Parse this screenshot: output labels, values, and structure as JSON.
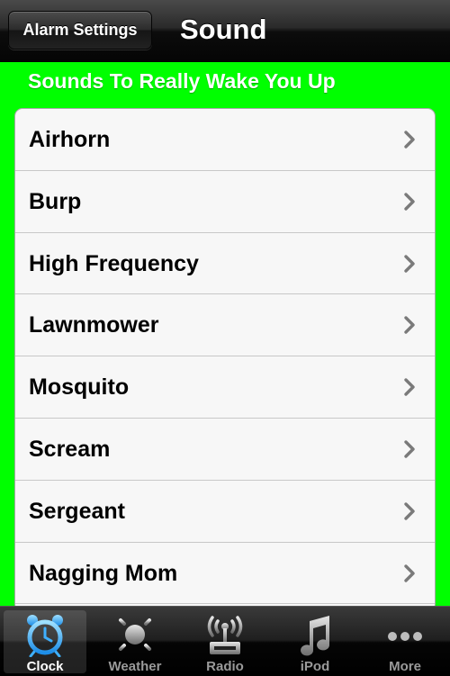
{
  "navbar": {
    "back_label": "Alarm Settings",
    "title": "Sound"
  },
  "section": {
    "header": "Sounds To Really Wake You Up"
  },
  "sounds": [
    {
      "label": "Airhorn"
    },
    {
      "label": "Burp"
    },
    {
      "label": "High Frequency"
    },
    {
      "label": "Lawnmower"
    },
    {
      "label": "Mosquito"
    },
    {
      "label": "Scream"
    },
    {
      "label": "Sergeant"
    },
    {
      "label": "Nagging Mom"
    }
  ],
  "tabbar": {
    "active": "Clock",
    "tabs": [
      {
        "label": "Clock",
        "icon": "alarm-clock-icon"
      },
      {
        "label": "Weather",
        "icon": "sun-icon"
      },
      {
        "label": "Radio",
        "icon": "radio-tower-icon"
      },
      {
        "label": "iPod",
        "icon": "music-note-icon"
      },
      {
        "label": "More",
        "icon": "more-dots-icon"
      }
    ]
  },
  "colors": {
    "background": "#00ff00",
    "accent_active": "#3fb0ff"
  }
}
